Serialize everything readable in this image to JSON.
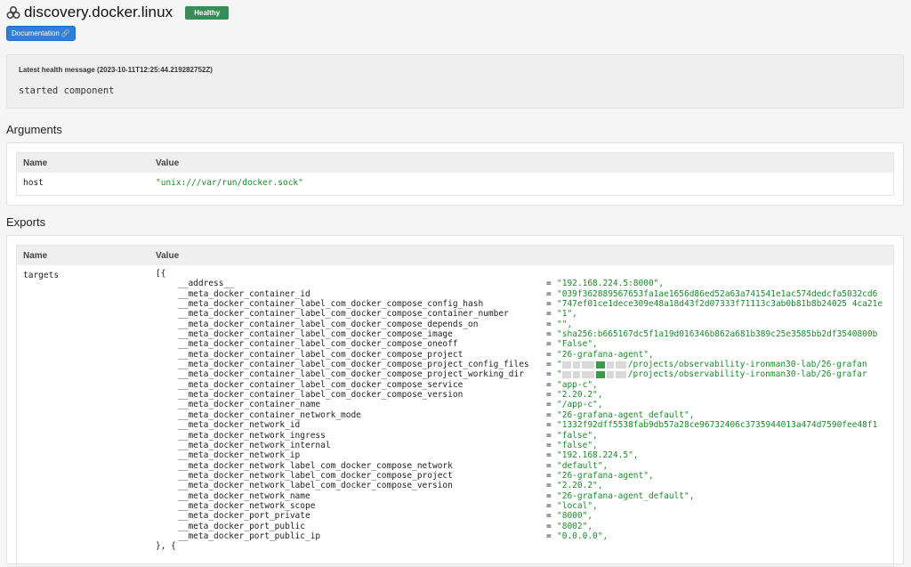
{
  "header": {
    "title": "discovery.docker.linux",
    "status_badge": "Healthy",
    "doc_button": "Documentation",
    "icon": "component-icon"
  },
  "health": {
    "title": "Latest health message (2023-10-11T12:25:44.219282752Z)",
    "message": "started component"
  },
  "arguments": {
    "section_title": "Arguments",
    "columns": [
      "Name",
      "Value"
    ],
    "rows": [
      {
        "name": "host",
        "value": "\"unix:///var/run/docker.sock\""
      }
    ]
  },
  "exports": {
    "section_title": "Exports",
    "columns": [
      "Name",
      "Value"
    ],
    "row_name": "targets",
    "open": "[{",
    "close": "}, {",
    "lines": [
      {
        "key": "__address__",
        "value": "\"192.168.224.5:8000\","
      },
      {
        "key": "__meta_docker_container_id",
        "value": "\"039f362889567653fa1ae1656d86ed52a63a741541e1ac574dedcfa5032cd6"
      },
      {
        "key": "__meta_docker_container_label_com_docker_compose_config_hash",
        "value": "\"747ef01ce1dece309e48a18d43f2d07333f71113c3ab0b81b8b24025 4ca21e"
      },
      {
        "key": "__meta_docker_container_label_com_docker_compose_container_number",
        "value": "\"1\","
      },
      {
        "key": "__meta_docker_container_label_com_docker_compose_depends_on",
        "value": "\"\","
      },
      {
        "key": "__meta_docker_container_label_com_docker_compose_image",
        "value": "\"sha256:b665167dc5f1a19d016346b862a681b389c25e3585bb2df3540800b"
      },
      {
        "key": "__meta_docker_container_label_com_docker_compose_oneoff",
        "value": "\"False\","
      },
      {
        "key": "__meta_docker_container_label_com_docker_compose_project",
        "value": "\"26-grafana-agent\","
      },
      {
        "key": "__meta_docker_container_label_com_docker_compose_project_config_files",
        "value": "/projects/observability-ironman30-lab/26-grafan",
        "redacted": true
      },
      {
        "key": "__meta_docker_container_label_com_docker_compose_project_working_dir",
        "value": "/projects/observability-ironman30-lab/26-grafar",
        "redacted": true
      },
      {
        "key": "__meta_docker_container_label_com_docker_compose_service",
        "value": "\"app-c\","
      },
      {
        "key": "__meta_docker_container_label_com_docker_compose_version",
        "value": "\"2.20.2\","
      },
      {
        "key": "__meta_docker_container_name",
        "value": "\"/app-c\","
      },
      {
        "key": "__meta_docker_container_network_mode",
        "value": "\"26-grafana-agent_default\","
      },
      {
        "key": "__meta_docker_network_id",
        "value": "\"1332f92dff5538fab9db57a28ce96732406c3735944013a474d7590fee48f1"
      },
      {
        "key": "__meta_docker_network_ingress",
        "value": "\"false\","
      },
      {
        "key": "__meta_docker_network_internal",
        "value": "\"false\","
      },
      {
        "key": "__meta_docker_network_ip",
        "value": "\"192.168.224.5\","
      },
      {
        "key": "__meta_docker_network_label_com_docker_compose_network",
        "value": "\"default\","
      },
      {
        "key": "__meta_docker_network_label_com_docker_compose_project",
        "value": "\"26-grafana-agent\","
      },
      {
        "key": "__meta_docker_network_label_com_docker_compose_version",
        "value": "\"2.20.2\","
      },
      {
        "key": "__meta_docker_network_name",
        "value": "\"26-grafana-agent_default\","
      },
      {
        "key": "__meta_docker_network_scope",
        "value": "\"local\","
      },
      {
        "key": "__meta_docker_port_private",
        "value": "\"8000\","
      },
      {
        "key": "__meta_docker_port_public",
        "value": "\"8002\","
      },
      {
        "key": "__meta_docker_port_public_ip",
        "value": "\"0.0.0.0\","
      }
    ]
  },
  "colors": {
    "badge": "#3b8b58",
    "doc_button": "#2f7fd6",
    "string_value": "#1a8a2a"
  }
}
